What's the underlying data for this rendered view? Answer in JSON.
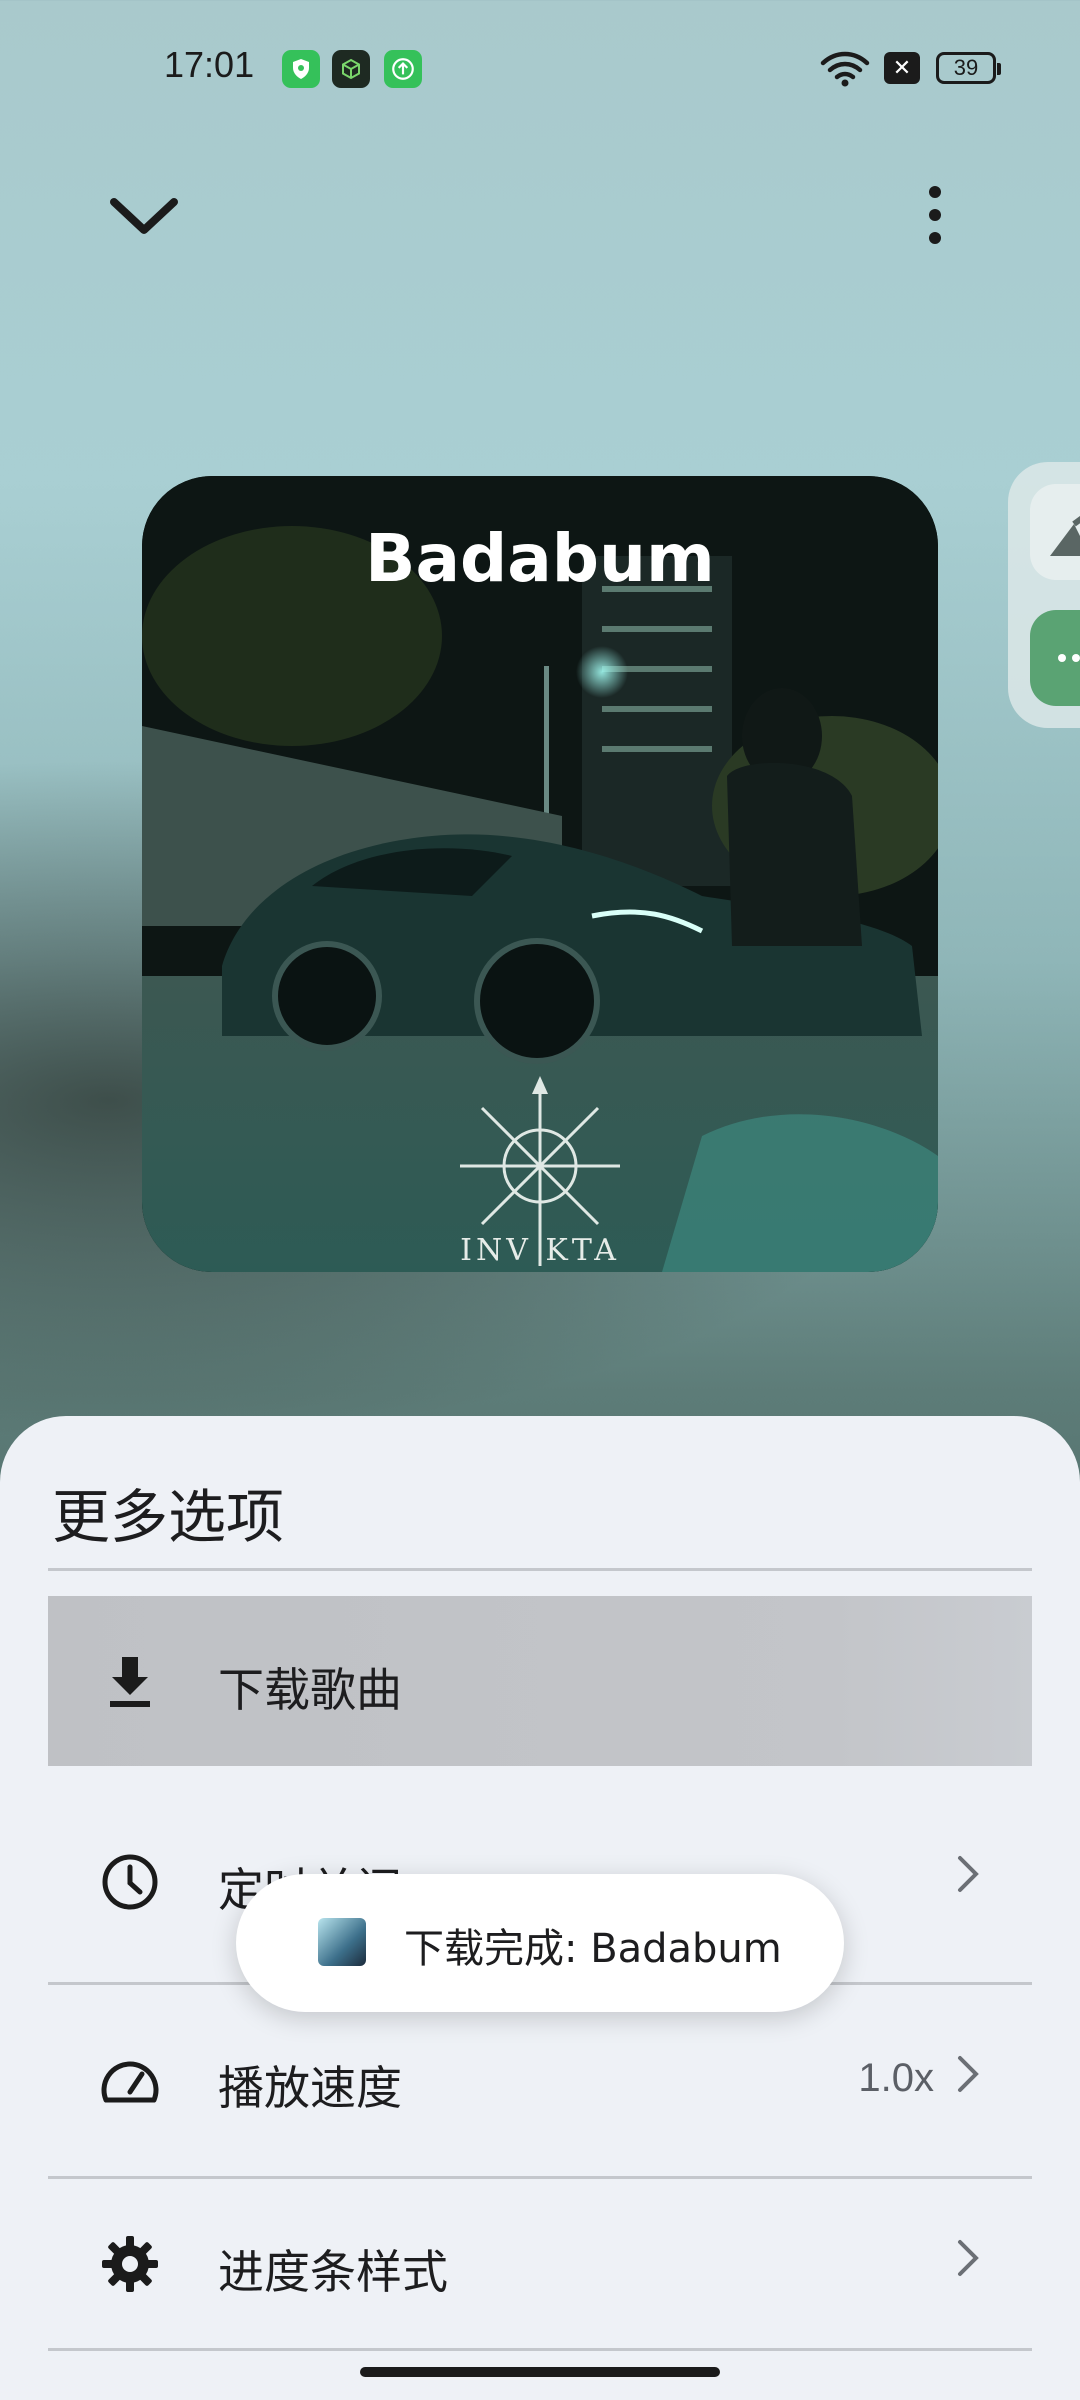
{
  "status_bar": {
    "time": "17:01",
    "battery": "39",
    "app_icons": [
      {
        "name": "shield-app-icon",
        "color": "#35c15a"
      },
      {
        "name": "cube-app-icon",
        "color": "#1e2a22"
      },
      {
        "name": "upload-app-icon",
        "color": "#35c15a"
      }
    ]
  },
  "player": {
    "collapse_icon": "chevron-down-icon",
    "more_icon": "more-vertical-icon",
    "album": {
      "title": "Badabum",
      "logo_text": "INV KTA"
    }
  },
  "sheet": {
    "title": "更多选项",
    "items": [
      {
        "label": "下载歌曲",
        "icon": "download-icon",
        "value": "",
        "has_chevron": false
      },
      {
        "label": "定时关闭",
        "icon": "clock-icon",
        "value": "",
        "has_chevron": true
      },
      {
        "label": "播放速度",
        "icon": "speedometer-icon",
        "value": "1.0x",
        "has_chevron": true
      },
      {
        "label": "进度条样式",
        "icon": "gear-icon",
        "value": "",
        "has_chevron": true
      }
    ]
  },
  "toast": {
    "text": "下载完成: Badabum"
  }
}
